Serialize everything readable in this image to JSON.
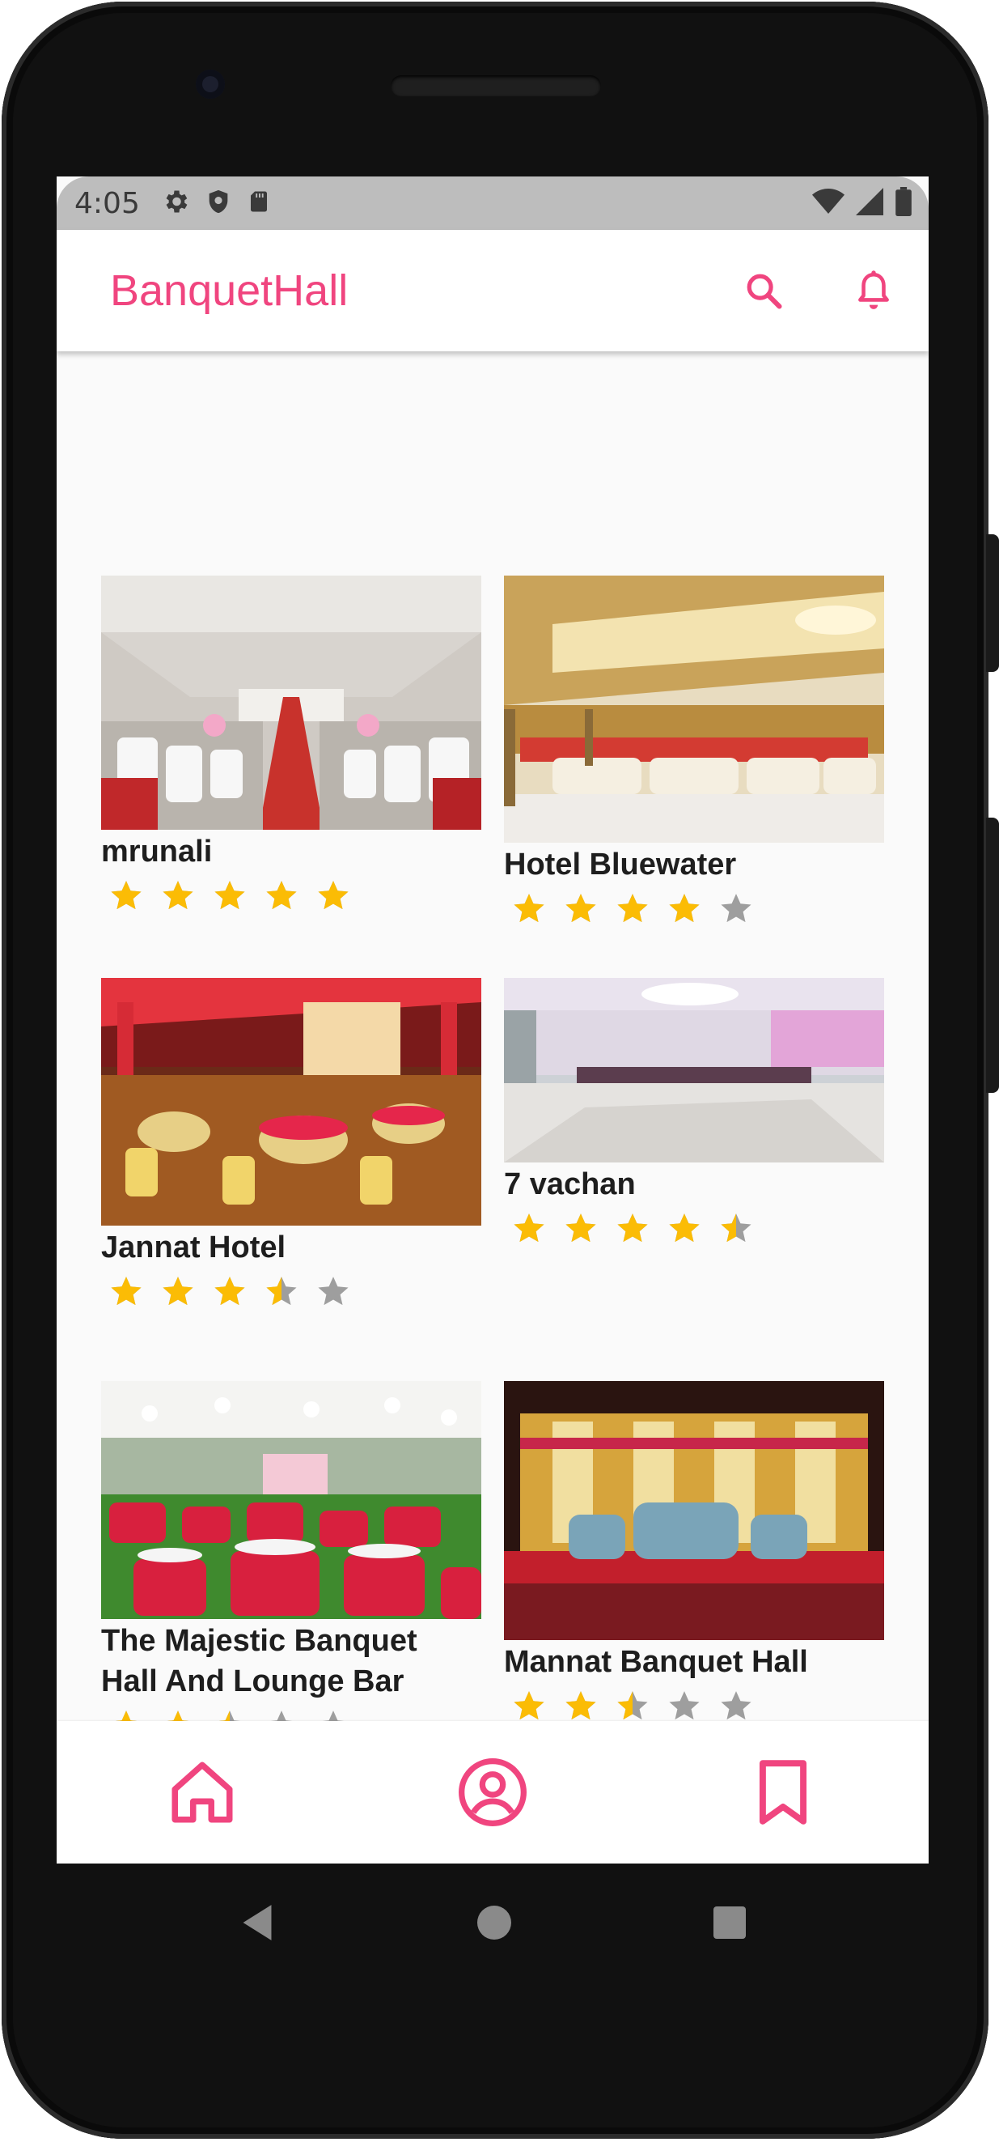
{
  "status_bar": {
    "time": "4:05"
  },
  "app_bar": {
    "title": "BanquetHall",
    "accent_color": "#f0457f",
    "icons": [
      "search-icon",
      "bell-icon"
    ]
  },
  "venues": [
    {
      "name": "mrunali",
      "rating": 5
    },
    {
      "name": "Hotel Bluewater",
      "rating": 4
    },
    {
      "name": "Jannat Hotel",
      "rating": 3.5
    },
    {
      "name": "7 vachan",
      "rating": 4.5
    },
    {
      "name": "The Majestic Banquet Hall And Lounge Bar",
      "rating": 2.5
    },
    {
      "name": "Mannat Banquet Hall",
      "rating": 2.5
    }
  ],
  "bottom_nav": {
    "icons": [
      "home-icon",
      "profile-icon",
      "bookmark-icon"
    ]
  },
  "colors": {
    "star_filled": "#fbbc05",
    "star_empty": "#9e9e9e"
  }
}
